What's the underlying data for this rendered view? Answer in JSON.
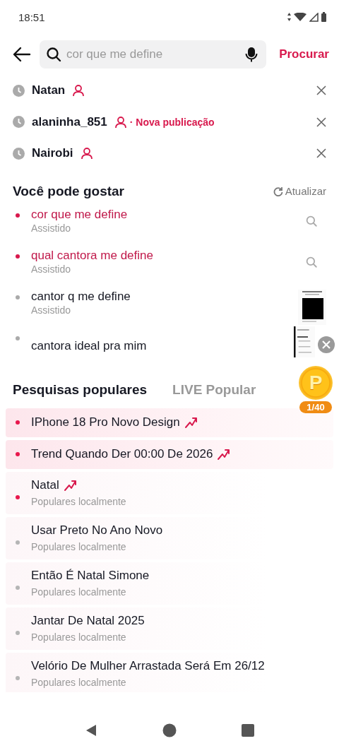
{
  "status_bar": {
    "time": "18:51"
  },
  "search": {
    "placeholder": "cor que me define",
    "submit": "Procurar"
  },
  "history": [
    {
      "text": "Natan",
      "user": true
    },
    {
      "text": "alaninha_851",
      "user": true,
      "note": "· Nova publicação"
    },
    {
      "text": "Nairobi",
      "user": true
    }
  ],
  "suggestions": {
    "title": "Você pode gostar",
    "refresh": "Atualizar",
    "items": [
      {
        "text": "cor que me define",
        "sub": "Assistido",
        "highlighted": true,
        "kind": "search"
      },
      {
        "text": "qual cantora me define",
        "sub": "Assistido",
        "highlighted": true,
        "kind": "search"
      },
      {
        "text": "cantor q me define",
        "sub": "Assistido",
        "highlighted": false,
        "kind": "thumbnail"
      },
      {
        "text": "cantora ideal pra mim",
        "highlighted": false,
        "kind": "preview"
      }
    ]
  },
  "popular": {
    "tabs": [
      {
        "label": "Pesquisas populares",
        "selected": true
      },
      {
        "label": "LIVE Popular",
        "selected": false
      }
    ],
    "items": [
      {
        "text": "IPhone 18 Pro Novo Design",
        "hot": true,
        "trending": true,
        "highlighted": true
      },
      {
        "text": "Trend Quando Der 00:00 De 2026",
        "hot": true,
        "trending": true,
        "highlighted": true
      },
      {
        "text": "Natal",
        "sub": "Populares localmente",
        "hot": true,
        "trending": true,
        "highlighted": false
      },
      {
        "text": "Usar Preto No Ano Novo",
        "sub": "Populares localmente",
        "hot": false,
        "trending": false,
        "highlighted": false
      },
      {
        "text": "Então É Natal Simone",
        "sub": "Populares localmente",
        "hot": false,
        "trending": false,
        "highlighted": false
      },
      {
        "text": "Jantar De Natal 2025",
        "sub": "Populares localmente",
        "hot": false,
        "trending": false,
        "highlighted": false
      },
      {
        "text": "Velório De Mulher Arrastada Será Em 26/12",
        "sub": "Populares localmente",
        "hot": false,
        "trending": false,
        "highlighted": false
      }
    ]
  },
  "reward_widget": {
    "coin": "P",
    "counter": "1/40"
  }
}
